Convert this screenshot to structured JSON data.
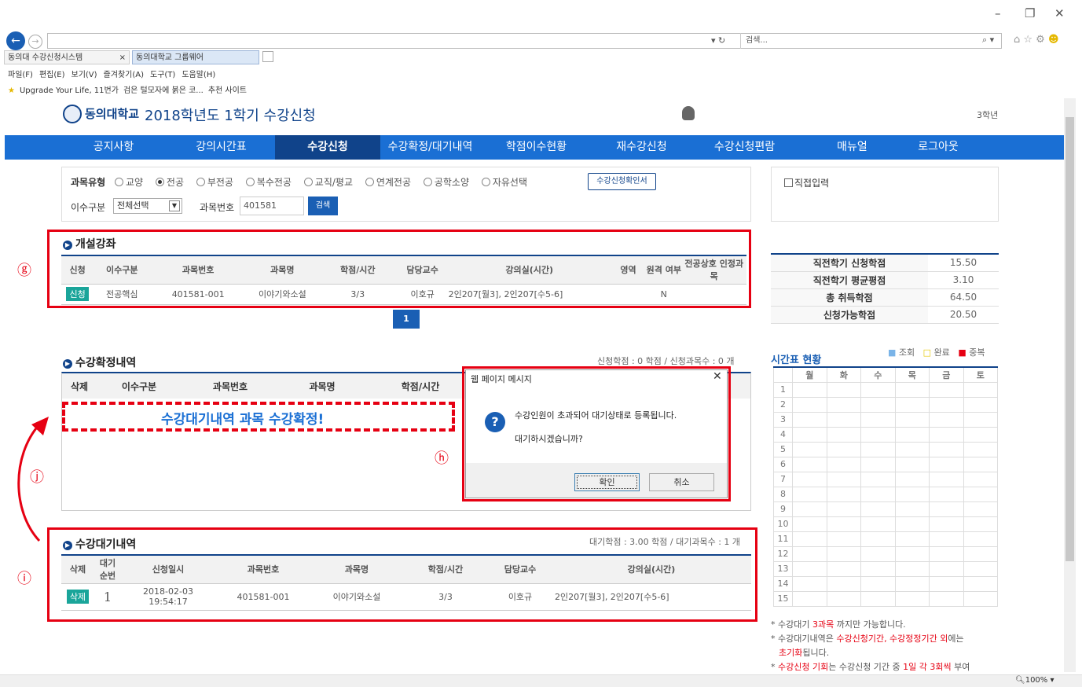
{
  "browser": {
    "search_placeholder": "검색...",
    "tab1": "동의대 수강신청시스템",
    "tab2": "동의대학교 그룹웨어",
    "menu": [
      "파일(F)",
      "편집(E)",
      "보기(V)",
      "즐겨찾기(A)",
      "도구(T)",
      "도움말(H)"
    ],
    "fav": [
      "Upgrade Your Life, 11번가",
      "검은 털모자에 붉은 코...",
      "추천 사이트"
    ],
    "zoom": "100%"
  },
  "header": {
    "logo": "동의대학교",
    "title": "2018학년도 1학기 수강신청",
    "grade": "3학년"
  },
  "nav": [
    "공지사항",
    "강의시간표",
    "수강신청",
    "수강확정/대기내역",
    "학점이수현황",
    "재수강신청",
    "수강신청편람",
    "매뉴얼",
    "로그아웃"
  ],
  "filter": {
    "type_label": "과목유형",
    "types": [
      "교양",
      "전공",
      "부전공",
      "복수전공",
      "교직/평교",
      "연계전공",
      "공학소양",
      "자유선택"
    ],
    "confirm_btn": "수강신청확인서",
    "division_label": "이수구분",
    "division_value": "전체선택",
    "code_label": "과목번호",
    "code_value": "401581",
    "search_btn": "검색",
    "direct": "직접입력"
  },
  "open": {
    "title": "개설강좌",
    "headers": [
      "신청",
      "이수구분",
      "과목번호",
      "과목명",
      "학점/시간",
      "담당교수",
      "강의실(시간)",
      "영역",
      "원격 여부",
      "전공상호 인정과목"
    ],
    "row": {
      "btn": "신청",
      "division": "전공핵심",
      "code": "401581-001",
      "name": "이야기와소설",
      "credit": "3/3",
      "prof": "이호규",
      "room": "2인207[월3], 2인207[수5-6]",
      "area": "",
      "remote": "N",
      "mutual": ""
    },
    "page": "1"
  },
  "stats": [
    [
      "직전학기 신청학점",
      "15.50"
    ],
    [
      "직전학기 평균평점",
      "3.10"
    ],
    [
      "총 취득학점",
      "64.50"
    ],
    [
      "신청가능학점",
      "20.50"
    ]
  ],
  "confirmed": {
    "title": "수강확정내역",
    "summary": "신청학점 : 0 학점 / 신청과목수 : 0 개",
    "headers": [
      "삭제",
      "이수구분",
      "과목번호",
      "과목명",
      "학점/시간"
    ],
    "overlay": "수강대기내역 과목 수강확정!"
  },
  "dialog": {
    "title": "웹 페이지 메시지",
    "line1": "수강인원이 초과되어 대기상태로 등록됩니다.",
    "line2": "대기하시겠습니까?",
    "ok": "확인",
    "cancel": "취소"
  },
  "waiting": {
    "title": "수강대기내역",
    "summary": "대기학점 : 3.00 학점 / 대기과목수 : 1 개",
    "headers": [
      "삭제",
      "대기 순번",
      "신청일시",
      "과목번호",
      "과목명",
      "학점/시간",
      "담당교수",
      "강의실(시간)"
    ],
    "row": {
      "btn": "삭제",
      "no": "1",
      "date": "2018-02-03",
      "time": "19:54:17",
      "code": "401581-001",
      "name": "이야기와소설",
      "credit": "3/3",
      "prof": "이호규",
      "room": "2인207[월3], 2인207[수5-6]"
    }
  },
  "timetable": {
    "title": "시간표 현황",
    "legend": [
      "조회",
      "완료",
      "중복"
    ],
    "days": [
      "월",
      "화",
      "수",
      "목",
      "금",
      "토"
    ],
    "periods": [
      "1",
      "2",
      "3",
      "4",
      "5",
      "6",
      "7",
      "8",
      "9",
      "10",
      "11",
      "12",
      "13",
      "14",
      "15"
    ]
  },
  "notes": {
    "n1a": "* 수강대기 ",
    "n1b": "3과목",
    "n1c": " 까지만 가능합니다.",
    "n2a": "* 수강대기내역은 ",
    "n2b": "수강신청기간, 수강정정기간 외",
    "n2c": "에는",
    "n2d": "초기화",
    "n2e": "됩니다.",
    "n3a": "* ",
    "n3b": "수강신청 기회",
    "n3c": "는 수강신청 기간 중 ",
    "n3d": "1일 각 3회씩",
    "n3e": " 부여"
  },
  "markers": {
    "g": "ⓖ",
    "h": "ⓗ",
    "i": "ⓘ",
    "j": "ⓙ"
  }
}
